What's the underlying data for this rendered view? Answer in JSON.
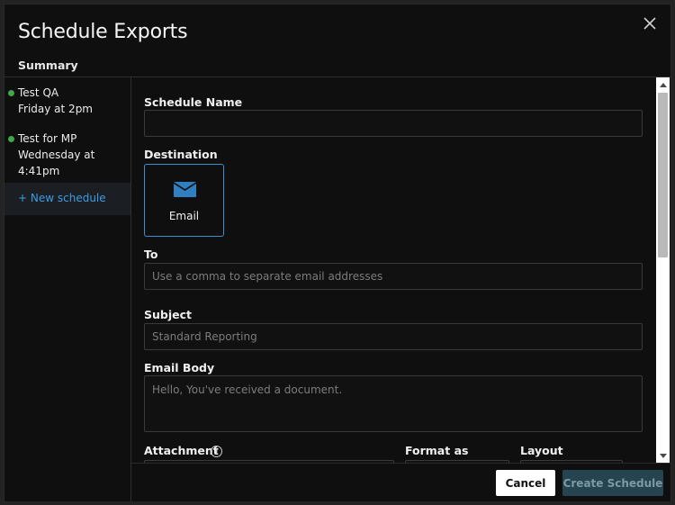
{
  "dialog": {
    "title": "Schedule Exports",
    "summary_label": "Summary"
  },
  "sidebar": {
    "schedules": [
      {
        "name": "Test QA",
        "when": "Friday at 2pm",
        "status_color": "#3ea84a"
      },
      {
        "name": "Test for MP",
        "when": "Wednesday at 4:41pm",
        "status_color": "#3ea84a"
      }
    ],
    "new_schedule_label": "+ New schedule"
  },
  "form": {
    "schedule_name": {
      "label": "Schedule Name",
      "value": "",
      "placeholder": ""
    },
    "destination": {
      "label": "Destination",
      "option": "Email",
      "icon": "envelope-icon"
    },
    "to": {
      "label": "To",
      "placeholder": "Use a comma to separate email addresses"
    },
    "subject": {
      "label": "Subject",
      "value": "Standard Reporting"
    },
    "email_body": {
      "label": "Email Body",
      "value": "Hello, You've received a document."
    },
    "attachment": {
      "label": "Attachment",
      "icon": "info-icon"
    },
    "format_as": {
      "label": "Format as"
    },
    "layout": {
      "label": "Layout"
    }
  },
  "footer": {
    "cancel_label": "Cancel",
    "create_label": "Create Schedule"
  },
  "colors": {
    "accent": "#3b8fd6",
    "link": "#3d9be0",
    "status_active": "#3ea84a",
    "create_disabled_bg": "#25444f"
  }
}
